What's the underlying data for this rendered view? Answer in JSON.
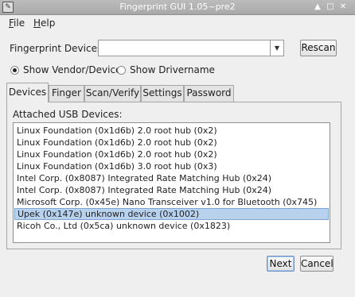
{
  "window": {
    "title": "Fingerprint GUI 1.05~pre2",
    "icon_name": "app-icon",
    "controls": [
      "up-icon",
      "maximize-icon",
      "close-icon"
    ]
  },
  "menu": {
    "file_first": "F",
    "file_rest": "ile",
    "help_first": "H",
    "help_rest": "elp"
  },
  "devices_row": {
    "label": "Fingerprint Devices:",
    "selected_value": "",
    "rescan_label": "Rescan"
  },
  "display_mode": {
    "options": [
      "Show Vendor/Device",
      "Show Drivername"
    ],
    "selected": "Show Vendor/Device"
  },
  "tabs": {
    "items": [
      "Devices",
      "Finger",
      "Scan/Verify",
      "Settings",
      "Password"
    ],
    "active": "Devices"
  },
  "devices_tab": {
    "list_label": "Attached USB Devices:",
    "usb_devices": [
      "Linux Foundation (0x1d6b) 2.0 root hub (0x2)",
      "Linux Foundation (0x1d6b) 2.0 root hub (0x2)",
      "Linux Foundation (0x1d6b) 2.0 root hub (0x2)",
      "Linux Foundation (0x1d6b) 3.0 root hub (0x3)",
      "Intel Corp. (0x8087) Integrated Rate Matching Hub (0x24)",
      "Intel Corp. (0x8087) Integrated Rate Matching Hub (0x24)",
      "Microsoft Corp. (0x45e) Nano Transceiver v1.0 for Bluetooth (0x745)",
      "Upek (0x147e) unknown device (0x1002)",
      "Ricoh Co., Ltd (0x5ca) unknown device (0x1823)"
    ],
    "selected_index": 7,
    "selection_color": "#b8d2ee"
  },
  "footer": {
    "next_label": "Next",
    "cancel_label": "Cancel"
  }
}
